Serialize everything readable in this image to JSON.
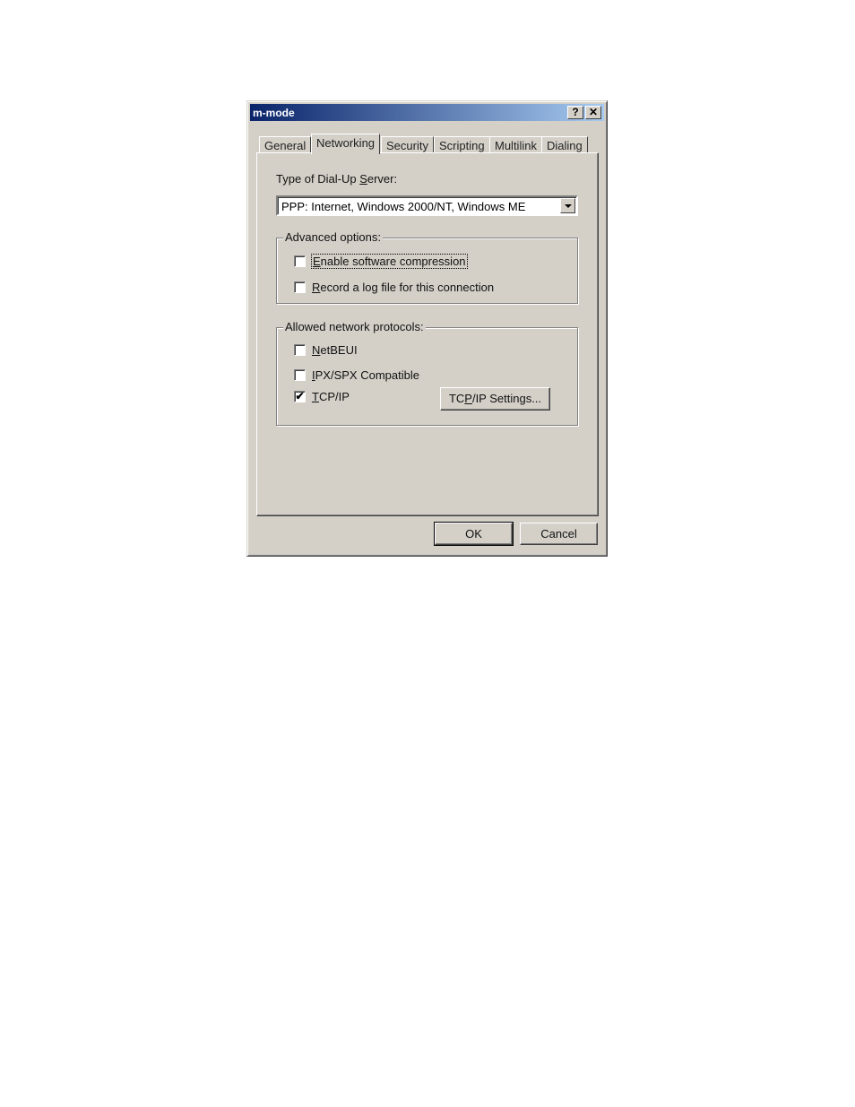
{
  "window": {
    "title": "m-mode",
    "help_button": "?",
    "close_button": "✕"
  },
  "tabs": [
    {
      "label": "General",
      "active": false
    },
    {
      "label": "Networking",
      "active": true
    },
    {
      "label": "Security",
      "active": false
    },
    {
      "label": "Scripting",
      "active": false
    },
    {
      "label": "Multilink",
      "active": false
    },
    {
      "label": "Dialing",
      "active": false
    }
  ],
  "server_type": {
    "label_pre": "Type of Dial-Up ",
    "label_accel": "S",
    "label_post": "erver:",
    "selected": "PPP: Internet, Windows 2000/NT, Windows ME"
  },
  "advanced": {
    "legend": "Advanced options:",
    "options": [
      {
        "accel": "E",
        "rest": "nable software compression",
        "checked": false,
        "focused": true
      },
      {
        "accel": "R",
        "rest": "ecord a log file for this connection",
        "checked": false,
        "focused": false
      }
    ]
  },
  "protocols": {
    "legend": "Allowed network protocols:",
    "items": [
      {
        "pre": "",
        "accel": "N",
        "rest": "etBEUI",
        "checked": false
      },
      {
        "pre": "",
        "accel": "I",
        "rest": "PX/SPX Compatible",
        "checked": false
      },
      {
        "pre": "",
        "accel": "T",
        "rest": "CP/IP",
        "checked": true
      }
    ],
    "settings_button": {
      "pre": "TC",
      "accel": "P",
      "post": "/IP Settings..."
    }
  },
  "footer": {
    "ok": "OK",
    "cancel": "Cancel"
  },
  "check_glyph": "✔"
}
